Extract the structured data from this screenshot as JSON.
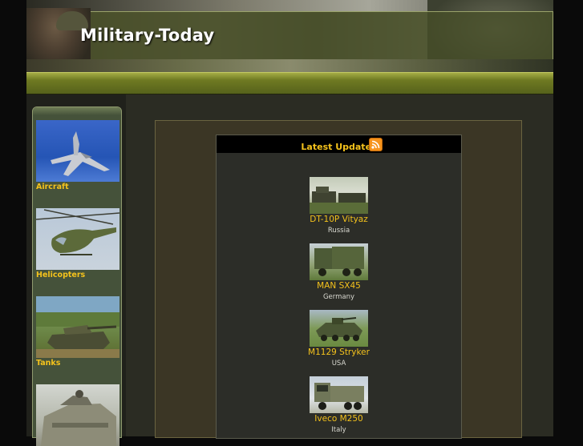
{
  "site": {
    "title": "Military-Today"
  },
  "sidebar": {
    "categories": [
      {
        "label": "Aircraft"
      },
      {
        "label": "Helicopters"
      },
      {
        "label": "Tanks"
      }
    ]
  },
  "updates": {
    "title": "Latest Updates",
    "rss_icon": "rss-icon",
    "items": [
      {
        "name": "DT-10P Vityaz",
        "country": "Russia"
      },
      {
        "name": "MAN SX45",
        "country": "Germany"
      },
      {
        "name": "M1129 Stryker",
        "country": "USA"
      },
      {
        "name": "Iveco M250",
        "country": "Italy"
      }
    ]
  },
  "colors": {
    "accent": "#f4c21c",
    "navbar": "#6f7a22",
    "sidebar": "#45523a",
    "content": "#3b3625"
  }
}
